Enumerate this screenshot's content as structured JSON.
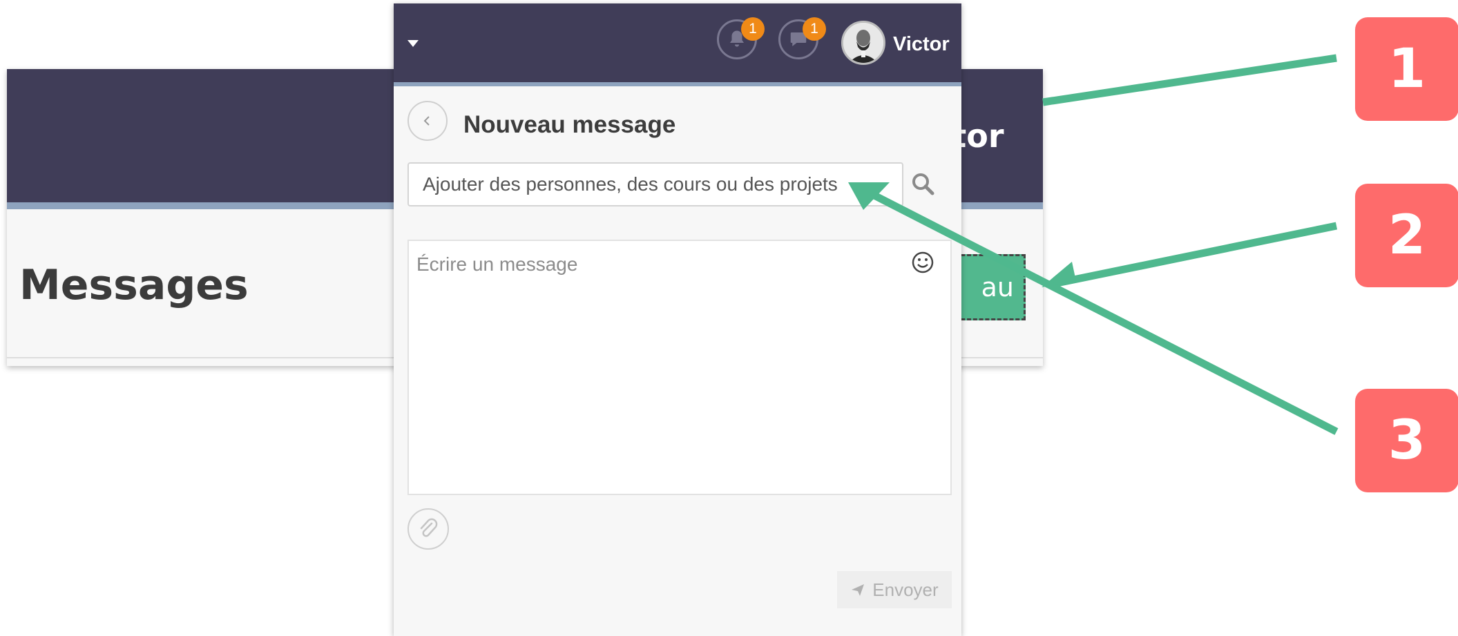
{
  "background_page": {
    "username": "ctor",
    "title": "Messages",
    "new_button_label": "au"
  },
  "header": {
    "notifications_count": "1",
    "messages_count": "1",
    "username": "Victor"
  },
  "compose": {
    "title": "Nouveau message",
    "recipient_placeholder": "Ajouter des personnes, des cours ou des projets",
    "message_placeholder": "Écrire un message",
    "send_label": "Envoyer"
  },
  "callouts": [
    "1",
    "2",
    "3"
  ],
  "colors": {
    "header": "#403d58",
    "header_accent": "#8ea3be",
    "badge": "#f08a17",
    "arrow": "#4fb88e",
    "callout": "#fe6b6b",
    "primary_button": "#52b88e"
  },
  "icons": {
    "back": "chevron-left-icon",
    "search": "search-icon",
    "emoji": "smiley-icon",
    "attach": "paperclip-icon",
    "send": "paper-plane-icon",
    "notifications": "bell-icon",
    "messages": "speech-bubble-icon"
  }
}
